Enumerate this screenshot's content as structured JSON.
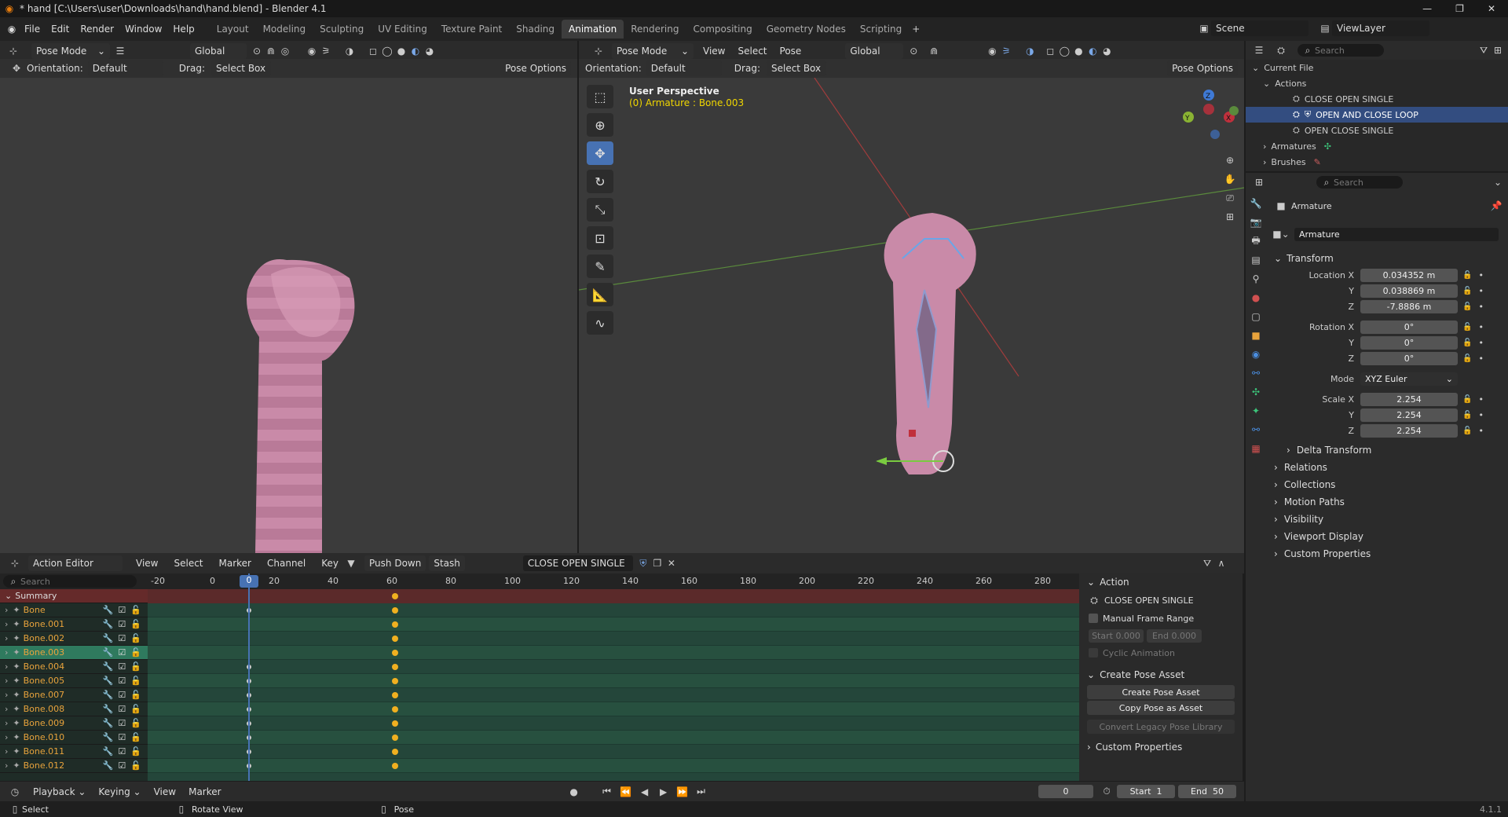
{
  "titlebar": {
    "title": "* hand [C:\\Users\\user\\Downloads\\hand\\hand.blend] - Blender 4.1"
  },
  "menu": [
    "File",
    "Edit",
    "Render",
    "Window",
    "Help"
  ],
  "workspaces": [
    "Layout",
    "Modeling",
    "Sculpting",
    "UV Editing",
    "Texture Paint",
    "Shading",
    "Animation",
    "Rendering",
    "Compositing",
    "Geometry Nodes",
    "Scripting"
  ],
  "active_workspace": "Animation",
  "scene": {
    "scene_label": "Scene",
    "viewlayer_label": "ViewLayer"
  },
  "left_vp": {
    "mode": "Pose Mode",
    "orientation_space": "Global",
    "orientation_label": "Orientation:",
    "orientation_value": "Default",
    "drag_label": "Drag:",
    "drag_value": "Select Box",
    "pose_options": "Pose Options"
  },
  "right_vp": {
    "mode": "Pose Mode",
    "view": "View",
    "select": "Select",
    "pose": "Pose",
    "orientation_space": "Global",
    "orientation_label": "Orientation:",
    "orientation_value": "Default",
    "drag_label": "Drag:",
    "drag_value": "Select Box",
    "pose_options": "Pose Options",
    "overlay_title": "User Perspective",
    "overlay_sub": "(0) Armature : Bone.003"
  },
  "action_editor": {
    "editor": "Action Editor",
    "menu": [
      "View",
      "Select",
      "Marker",
      "Channel",
      "Key"
    ],
    "push_down": "Push Down",
    "stash": "Stash",
    "action_name": "CLOSE OPEN SINGLE",
    "search_placeholder": "Search",
    "ruler": [
      "-20",
      "0",
      "20",
      "40",
      "60",
      "80",
      "100",
      "120",
      "140",
      "160",
      "180",
      "200",
      "220",
      "240",
      "260",
      "280"
    ],
    "current_frame": "0",
    "summary": "Summary",
    "channels": [
      "Bone",
      "Bone.001",
      "Bone.002",
      "Bone.003",
      "Bone.004",
      "Bone.005",
      "Bone.007",
      "Bone.008",
      "Bone.009",
      "Bone.010",
      "Bone.011",
      "Bone.012"
    ],
    "panel": {
      "action_title": "Action",
      "action_name": "CLOSE OPEN SINGLE",
      "manual_range": "Manual Frame Range",
      "start_label": "Start",
      "start_value": "0.000",
      "end_label": "End",
      "end_value": "0.000",
      "cyclic": "Cyclic Animation",
      "pose_asset_title": "Create Pose Asset",
      "create_pose_asset": "Create Pose Asset",
      "copy_pose": "Copy Pose as Asset",
      "convert_legacy": "Convert Legacy Pose Library",
      "custom_props": "Custom Properties"
    }
  },
  "timeline": {
    "playback": "Playback",
    "keying": "Keying",
    "view": "View",
    "marker": "Marker",
    "frame": "0",
    "start_label": "Start",
    "start": "1",
    "end_label": "End",
    "end": "50"
  },
  "outliner": {
    "search_placeholder": "Search",
    "current_file": "Current File",
    "actions": "Actions",
    "items": [
      "CLOSE OPEN SINGLE",
      "OPEN AND CLOSE LOOP",
      "OPEN CLOSE SINGLE"
    ],
    "selected_index": 1,
    "armatures": "Armatures",
    "brushes": "Brushes"
  },
  "properties": {
    "search_placeholder": "Search",
    "object_name": "Armature",
    "data_name": "Armature",
    "transform": "Transform",
    "location_label": "Location X",
    "y": "Y",
    "z": "Z",
    "location": [
      "0.034352 m",
      "0.038869 m",
      "-7.8886 m"
    ],
    "rotation_label": "Rotation X",
    "rotation": [
      "0°",
      "0°",
      "0°"
    ],
    "mode_label": "Mode",
    "mode_value": "XYZ Euler",
    "scale_label": "Scale X",
    "scale": [
      "2.254",
      "2.254",
      "2.254"
    ],
    "sections": [
      "Delta Transform",
      "Relations",
      "Collections",
      "Motion Paths",
      "Visibility",
      "Viewport Display",
      "Custom Properties"
    ]
  },
  "status": {
    "select": "Select",
    "rotate": "Rotate View",
    "pose": "Pose",
    "version": "4.1.1"
  }
}
